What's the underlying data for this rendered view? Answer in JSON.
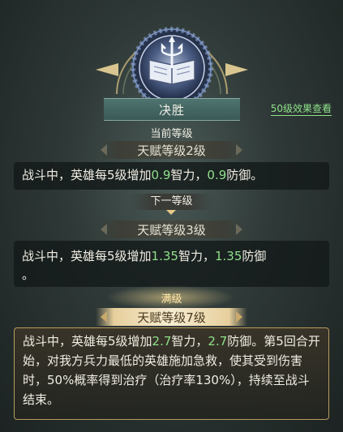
{
  "talent": {
    "name": "决胜",
    "icon": "book-trident-icon",
    "view_link": "50级效果查看"
  },
  "current": {
    "section_label": "当前等级",
    "level_label": "天赋等级2级",
    "desc_prefix": "战斗中，英雄每5级增加",
    "int_value": "0.9",
    "int_suffix": "智力，",
    "def_value": "0.9",
    "def_suffix": "防御。"
  },
  "next": {
    "section_label": "下一等级",
    "level_label": "天赋等级3级",
    "desc_prefix": "战斗中，英雄每5级增加",
    "int_value": "1.35",
    "int_suffix": "智力，",
    "def_value": "1.35",
    "def_suffix": "防御",
    "tail": "。"
  },
  "max": {
    "section_label": "满级",
    "level_label": "天赋等级7级",
    "desc_prefix": "战斗中，英雄每5级增加",
    "int_value": "2.7",
    "int_suffix": "智力，",
    "def_value": "2.7",
    "def_suffix": "防御。",
    "extra": "第5回合开始，对我方兵力最低的英雄施加急救，使其受到伤害时，50%概率得到治疗（治疗率130%），持续至战斗结束。"
  },
  "colors": {
    "highlight": "#8fe08a",
    "gold_border": "#b89b5e",
    "title_bar": "#3f605c"
  }
}
